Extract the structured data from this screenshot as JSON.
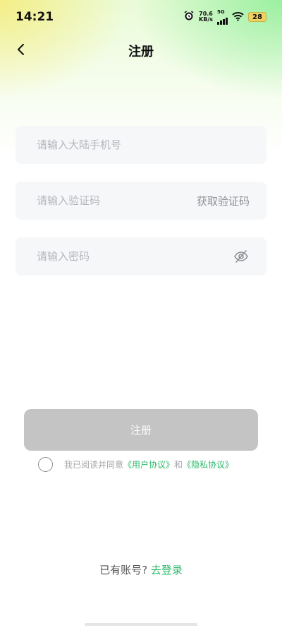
{
  "status_bar": {
    "time": "14:21",
    "net_speed_value": "70.6",
    "net_speed_unit": "KB/s",
    "network_type": "5G",
    "battery": "28",
    "icons": [
      "alarm-icon",
      "signal-icon",
      "wifi-icon",
      "battery-icon"
    ]
  },
  "nav": {
    "back_icon": "chevron-left-icon",
    "title": "注册"
  },
  "form": {
    "phone_placeholder": "请输入大陆手机号",
    "phone_value": "",
    "code_placeholder": "请输入验证码",
    "code_value": "",
    "get_code_label": "获取验证码",
    "password_placeholder": "请输入密码",
    "password_value": "",
    "eye_icon": "eye-off-icon"
  },
  "submit_label": "注册",
  "agreement": {
    "prefix": "我已阅读并同意",
    "user_agreement": "《用户协议》",
    "and": "和",
    "privacy_policy": "《隐私协议》",
    "checked": false
  },
  "login": {
    "prompt": "已有账号?",
    "link": "去登录"
  },
  "colors": {
    "accent": "#2cb86a",
    "button_disabled": "#c4c4c4",
    "field_bg": "#f6f7f9"
  }
}
